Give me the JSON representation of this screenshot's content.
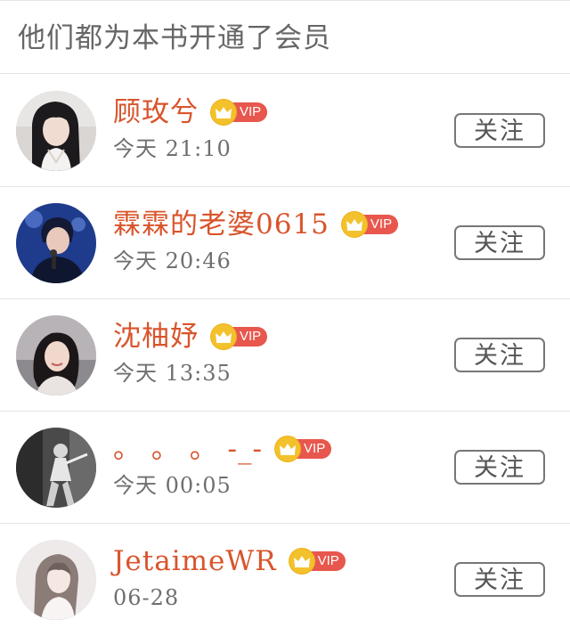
{
  "header": {
    "title": "他们都为本书开通了会员"
  },
  "colors": {
    "name": "#d9542b",
    "vip_badge": "#e8574d",
    "crown": "#f3c12c"
  },
  "members": [
    {
      "name": "顾玫兮",
      "vip_label": "VIP",
      "time": "今天 21:10",
      "follow_label": "关注",
      "avatar_icon": "avatar-girl-dark-hair"
    },
    {
      "name": "霖霖的老婆0615",
      "vip_label": "VIP",
      "time": "今天 20:46",
      "follow_label": "关注",
      "avatar_icon": "avatar-singer-stage"
    },
    {
      "name": "沈柚妤",
      "vip_label": "VIP",
      "time": "今天 13:35",
      "follow_label": "关注",
      "avatar_icon": "avatar-woman-smiling"
    },
    {
      "name": "。 。 。 -_-",
      "vip_label": "VIP",
      "time": "今天 00:05",
      "follow_label": "关注",
      "avatar_icon": "avatar-dancer-monochrome"
    },
    {
      "name": "JetaimeWR",
      "vip_label": "VIP",
      "time": "06-28",
      "follow_label": "关注",
      "avatar_icon": "avatar-girl-pale"
    }
  ]
}
